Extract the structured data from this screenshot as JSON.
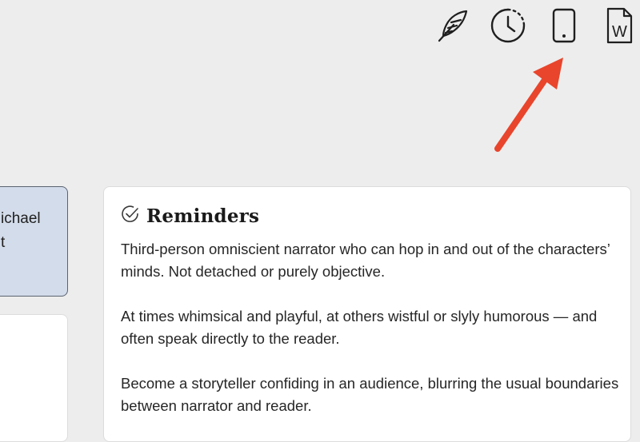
{
  "toolbar": {
    "icons": [
      "quill-icon",
      "history-icon",
      "mobile-icon",
      "word-document-icon"
    ],
    "word_icon_letter": "W"
  },
  "annotation": {
    "arrow_color": "#e8452c"
  },
  "left_card": {
    "text": "ichael\nt"
  },
  "reminders": {
    "title": "Reminders",
    "paragraphs": [
      "Third-person omniscient narrator who can hop in and out of the characters’ minds. Not detached or purely objective.",
      "At times whimsical and playful, at others wistful or slyly humorous — and often speak directly to the reader.",
      "Become a storyteller confiding in an audience, blurring the usual boundaries between narrator and reader."
    ]
  },
  "colors": {
    "background": "#ededed",
    "card_blue": "#d3dcea",
    "card_white": "#ffffff",
    "arrow": "#e8452c"
  }
}
